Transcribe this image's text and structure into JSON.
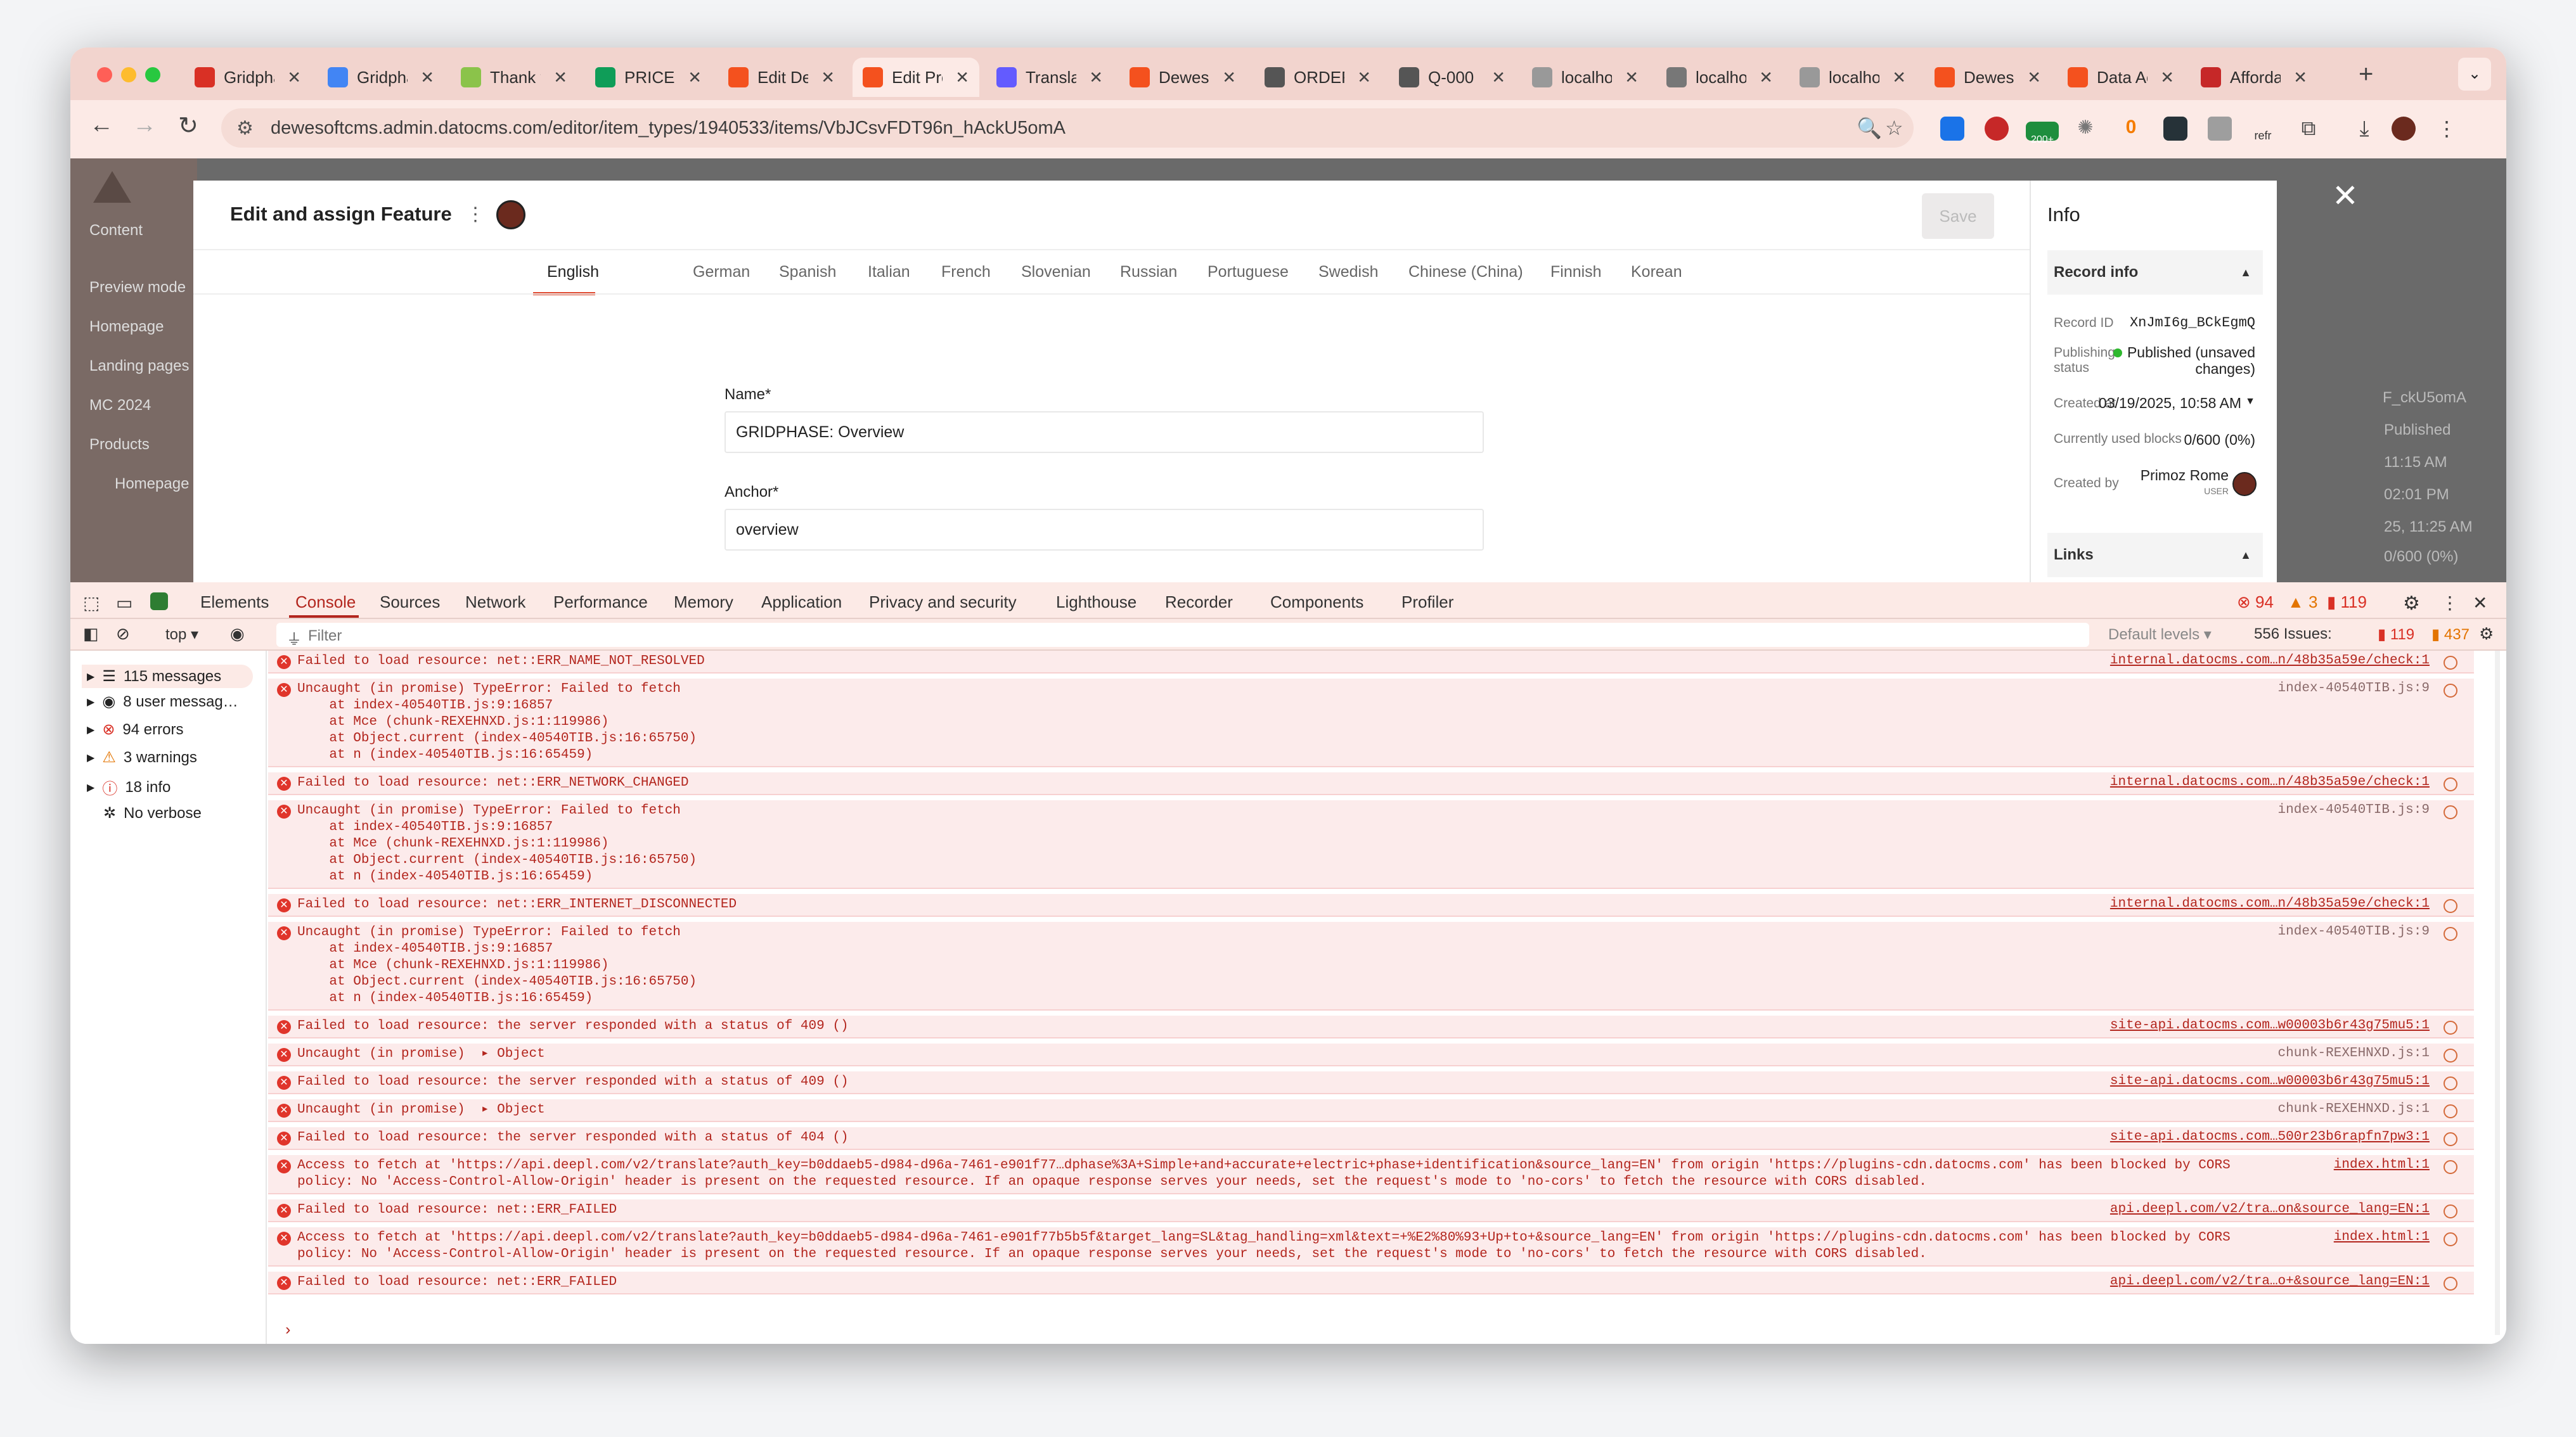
{
  "tabs": [
    {
      "label": "Gridphase",
      "color": "#d93025",
      "icon": "gmail-icon"
    },
    {
      "label": "Gridphase",
      "color": "#4285f4",
      "icon": "docs-icon"
    },
    {
      "label": "Thank you",
      "color": "#8bc34a",
      "icon": "page-icon"
    },
    {
      "label": "PRICE",
      "color": "#0f9d58",
      "icon": "drive-icon"
    },
    {
      "label": "Edit Dewesoft",
      "color": "#f4511e",
      "icon": "datocms-icon"
    },
    {
      "label": "Edit Product",
      "color": "#f4511e",
      "icon": "datocms-icon"
    },
    {
      "label": "Translate",
      "color": "#635bff",
      "icon": "stripe-icon"
    },
    {
      "label": "Dewesoft",
      "color": "#f4511e",
      "icon": "dewesoft-icon"
    },
    {
      "label": "ORDERS",
      "color": "#555555",
      "icon": "chart-icon"
    },
    {
      "label": "Q-000",
      "color": "#555555",
      "icon": "chart-icon"
    },
    {
      "label": "localhost",
      "color": "#999999",
      "icon": "triangle-icon"
    },
    {
      "label": "localhost",
      "color": "#777777",
      "icon": "star-icon"
    },
    {
      "label": "localhost",
      "color": "#999999",
      "icon": "triangle-icon"
    },
    {
      "label": "Dewesoft",
      "color": "#f4511e",
      "icon": "dewesoft-icon"
    },
    {
      "label": "Data Acquisition",
      "color": "#f4511e",
      "icon": "dewesoft-icon"
    },
    {
      "label": "Affordable",
      "color": "#c62828",
      "icon": "star-icon"
    }
  ],
  "toolbar": {
    "url": "dewesoftcms.admin.datocms.com/editor/item_types/1940533/items/VbJCsvFDT96n_hAckU5omA",
    "ext_badge": "200+",
    "ext_counter": "0",
    "ext_refresh": "refr"
  },
  "app": {
    "nav": [
      "Content",
      "Preview mode",
      "Homepage",
      "Landing pages",
      "MC 2024",
      "Products",
      "Homepage"
    ],
    "bg_right": [
      "F_ckU5omA",
      "Published",
      "11:15 AM",
      "02:01 PM",
      "25, 11:25 AM",
      "0/600 (0%)"
    ]
  },
  "modal": {
    "title": "Edit and assign Feature",
    "save_label": "Save",
    "languages": [
      "English",
      "German",
      "Spanish",
      "Italian",
      "French",
      "Slovenian",
      "Russian",
      "Portuguese",
      "Swedish",
      "Chinese (China)",
      "Finnish",
      "Korean"
    ],
    "name_label": "Name*",
    "name_value": "GRIDPHASE: Overview",
    "anchor_label": "Anchor*",
    "anchor_value": "overview"
  },
  "info": {
    "title": "Info",
    "record_info": "Record info",
    "record_id_label": "Record ID",
    "record_id": "XnJmI6g_BCkEgmQ",
    "publishing_label_1": "Publishing",
    "publishing_label_2": "status",
    "publishing_value_1": "Published (unsaved",
    "publishing_value_2": "changes)",
    "created_at_label": "Created at",
    "created_at": "03/19/2025, 10:58 AM",
    "blocks_label": "Currently used blocks",
    "blocks": "0/600 (0%)",
    "created_by_label": "Created by",
    "created_by": "Primoz Rome",
    "created_by_role": "USER",
    "links": "Links",
    "status_color": "#2eb82e"
  },
  "devtools": {
    "tabs": [
      "Elements",
      "Console",
      "Sources",
      "Network",
      "Performance",
      "Memory",
      "Application",
      "Privacy and security",
      "Lighthouse",
      "Recorder",
      "Components",
      "Profiler"
    ],
    "errors": "94",
    "warnings": "3",
    "issues_badge": "119",
    "context": "top",
    "filter_placeholder": "Filter",
    "levels": "Default levels",
    "issues": "556 Issues:",
    "issues_err": "119",
    "issues_info": "437",
    "sidebar": [
      {
        "label": "115 messages",
        "icon": "list-icon"
      },
      {
        "label": "8 user messag…",
        "icon": "user-icon"
      },
      {
        "label": "94 errors",
        "icon": "error-icon"
      },
      {
        "label": "3 warnings",
        "icon": "warning-icon"
      },
      {
        "label": "18 info",
        "icon": "info-icon"
      },
      {
        "label": "No verbose",
        "icon": "bug-icon"
      }
    ],
    "prompt": "›"
  },
  "console": [
    {
      "text": "Failed to load resource: net::ERR_NAME_NOT_RESOLVED",
      "src": "internal.datocms.com…n/48b35a59e/check:1",
      "link": true
    },
    {
      "text": "Uncaught (in promise) TypeError: Failed to fetch\n    at index-40540TIB.js:9:16857\n    at Mce (chunk-REXEHNXD.js:1:119986)\n    at Object.current (index-40540TIB.js:16:65750)\n    at n (index-40540TIB.js:16:65459)",
      "src": "index-40540TIB.js:9",
      "link": false
    },
    {
      "text": "Failed to load resource: net::ERR_NETWORK_CHANGED",
      "src": "internal.datocms.com…n/48b35a59e/check:1",
      "link": true
    },
    {
      "text": "Uncaught (in promise) TypeError: Failed to fetch\n    at index-40540TIB.js:9:16857\n    at Mce (chunk-REXEHNXD.js:1:119986)\n    at Object.current (index-40540TIB.js:16:65750)\n    at n (index-40540TIB.js:16:65459)",
      "src": "index-40540TIB.js:9",
      "link": false
    },
    {
      "text": "Failed to load resource: net::ERR_INTERNET_DISCONNECTED",
      "src": "internal.datocms.com…n/48b35a59e/check:1",
      "link": true
    },
    {
      "text": "Uncaught (in promise) TypeError: Failed to fetch\n    at index-40540TIB.js:9:16857\n    at Mce (chunk-REXEHNXD.js:1:119986)\n    at Object.current (index-40540TIB.js:16:65750)\n    at n (index-40540TIB.js:16:65459)",
      "src": "index-40540TIB.js:9",
      "link": false
    },
    {
      "text": "Failed to load resource: the server responded with a status of 409 ()",
      "src": "site-api.datocms.com…w00003b6r43g75mu5:1",
      "link": true
    },
    {
      "text": "Uncaught (in promise)  ▸ Object",
      "src": "chunk-REXEHNXD.js:1",
      "link": false
    },
    {
      "text": "Failed to load resource: the server responded with a status of 409 ()",
      "src": "site-api.datocms.com…w00003b6r43g75mu5:1",
      "link": true
    },
    {
      "text": "Uncaught (in promise)  ▸ Object",
      "src": "chunk-REXEHNXD.js:1",
      "link": false
    },
    {
      "text": "Failed to load resource: the server responded with a status of 404 ()",
      "src": "site-api.datocms.com…500r23b6rapfn7pw3:1",
      "link": true
    },
    {
      "text": "Access to fetch at 'https://api.deepl.com/v2/translate?auth_key=b0ddaeb5-d984-d96a-7461-e901f77…dphase%3A+Simple+and+accurate+electric+phase+identification&source_lang=EN' from origin 'https://plugins-cdn.datocms.com' has been blocked by CORS\npolicy: No 'Access-Control-Allow-Origin' header is present on the requested resource. If an opaque response serves your needs, set the request's mode to 'no-cors' to fetch the resource with CORS disabled.",
      "src": "index.html:1",
      "link": true
    },
    {
      "text": "Failed to load resource: net::ERR_FAILED",
      "src": "api.deepl.com/v2/tra…on&source_lang=EN:1",
      "link": true
    },
    {
      "text": "Access to fetch at 'https://api.deepl.com/v2/translate?auth_key=b0ddaeb5-d984-d96a-7461-e901f77b5b5f&target_lang=SL&tag_handling=xml&text=+%E2%80%93+Up+to+&source_lang=EN' from origin 'https://plugins-cdn.datocms.com' has been blocked by CORS\npolicy: No 'Access-Control-Allow-Origin' header is present on the requested resource. If an opaque response serves your needs, set the request's mode to 'no-cors' to fetch the resource with CORS disabled.",
      "src": "index.html:1",
      "link": true
    },
    {
      "text": "Failed to load resource: net::ERR_FAILED",
      "src": "api.deepl.com/v2/tra…o+&source_lang=EN:1",
      "link": true
    }
  ]
}
